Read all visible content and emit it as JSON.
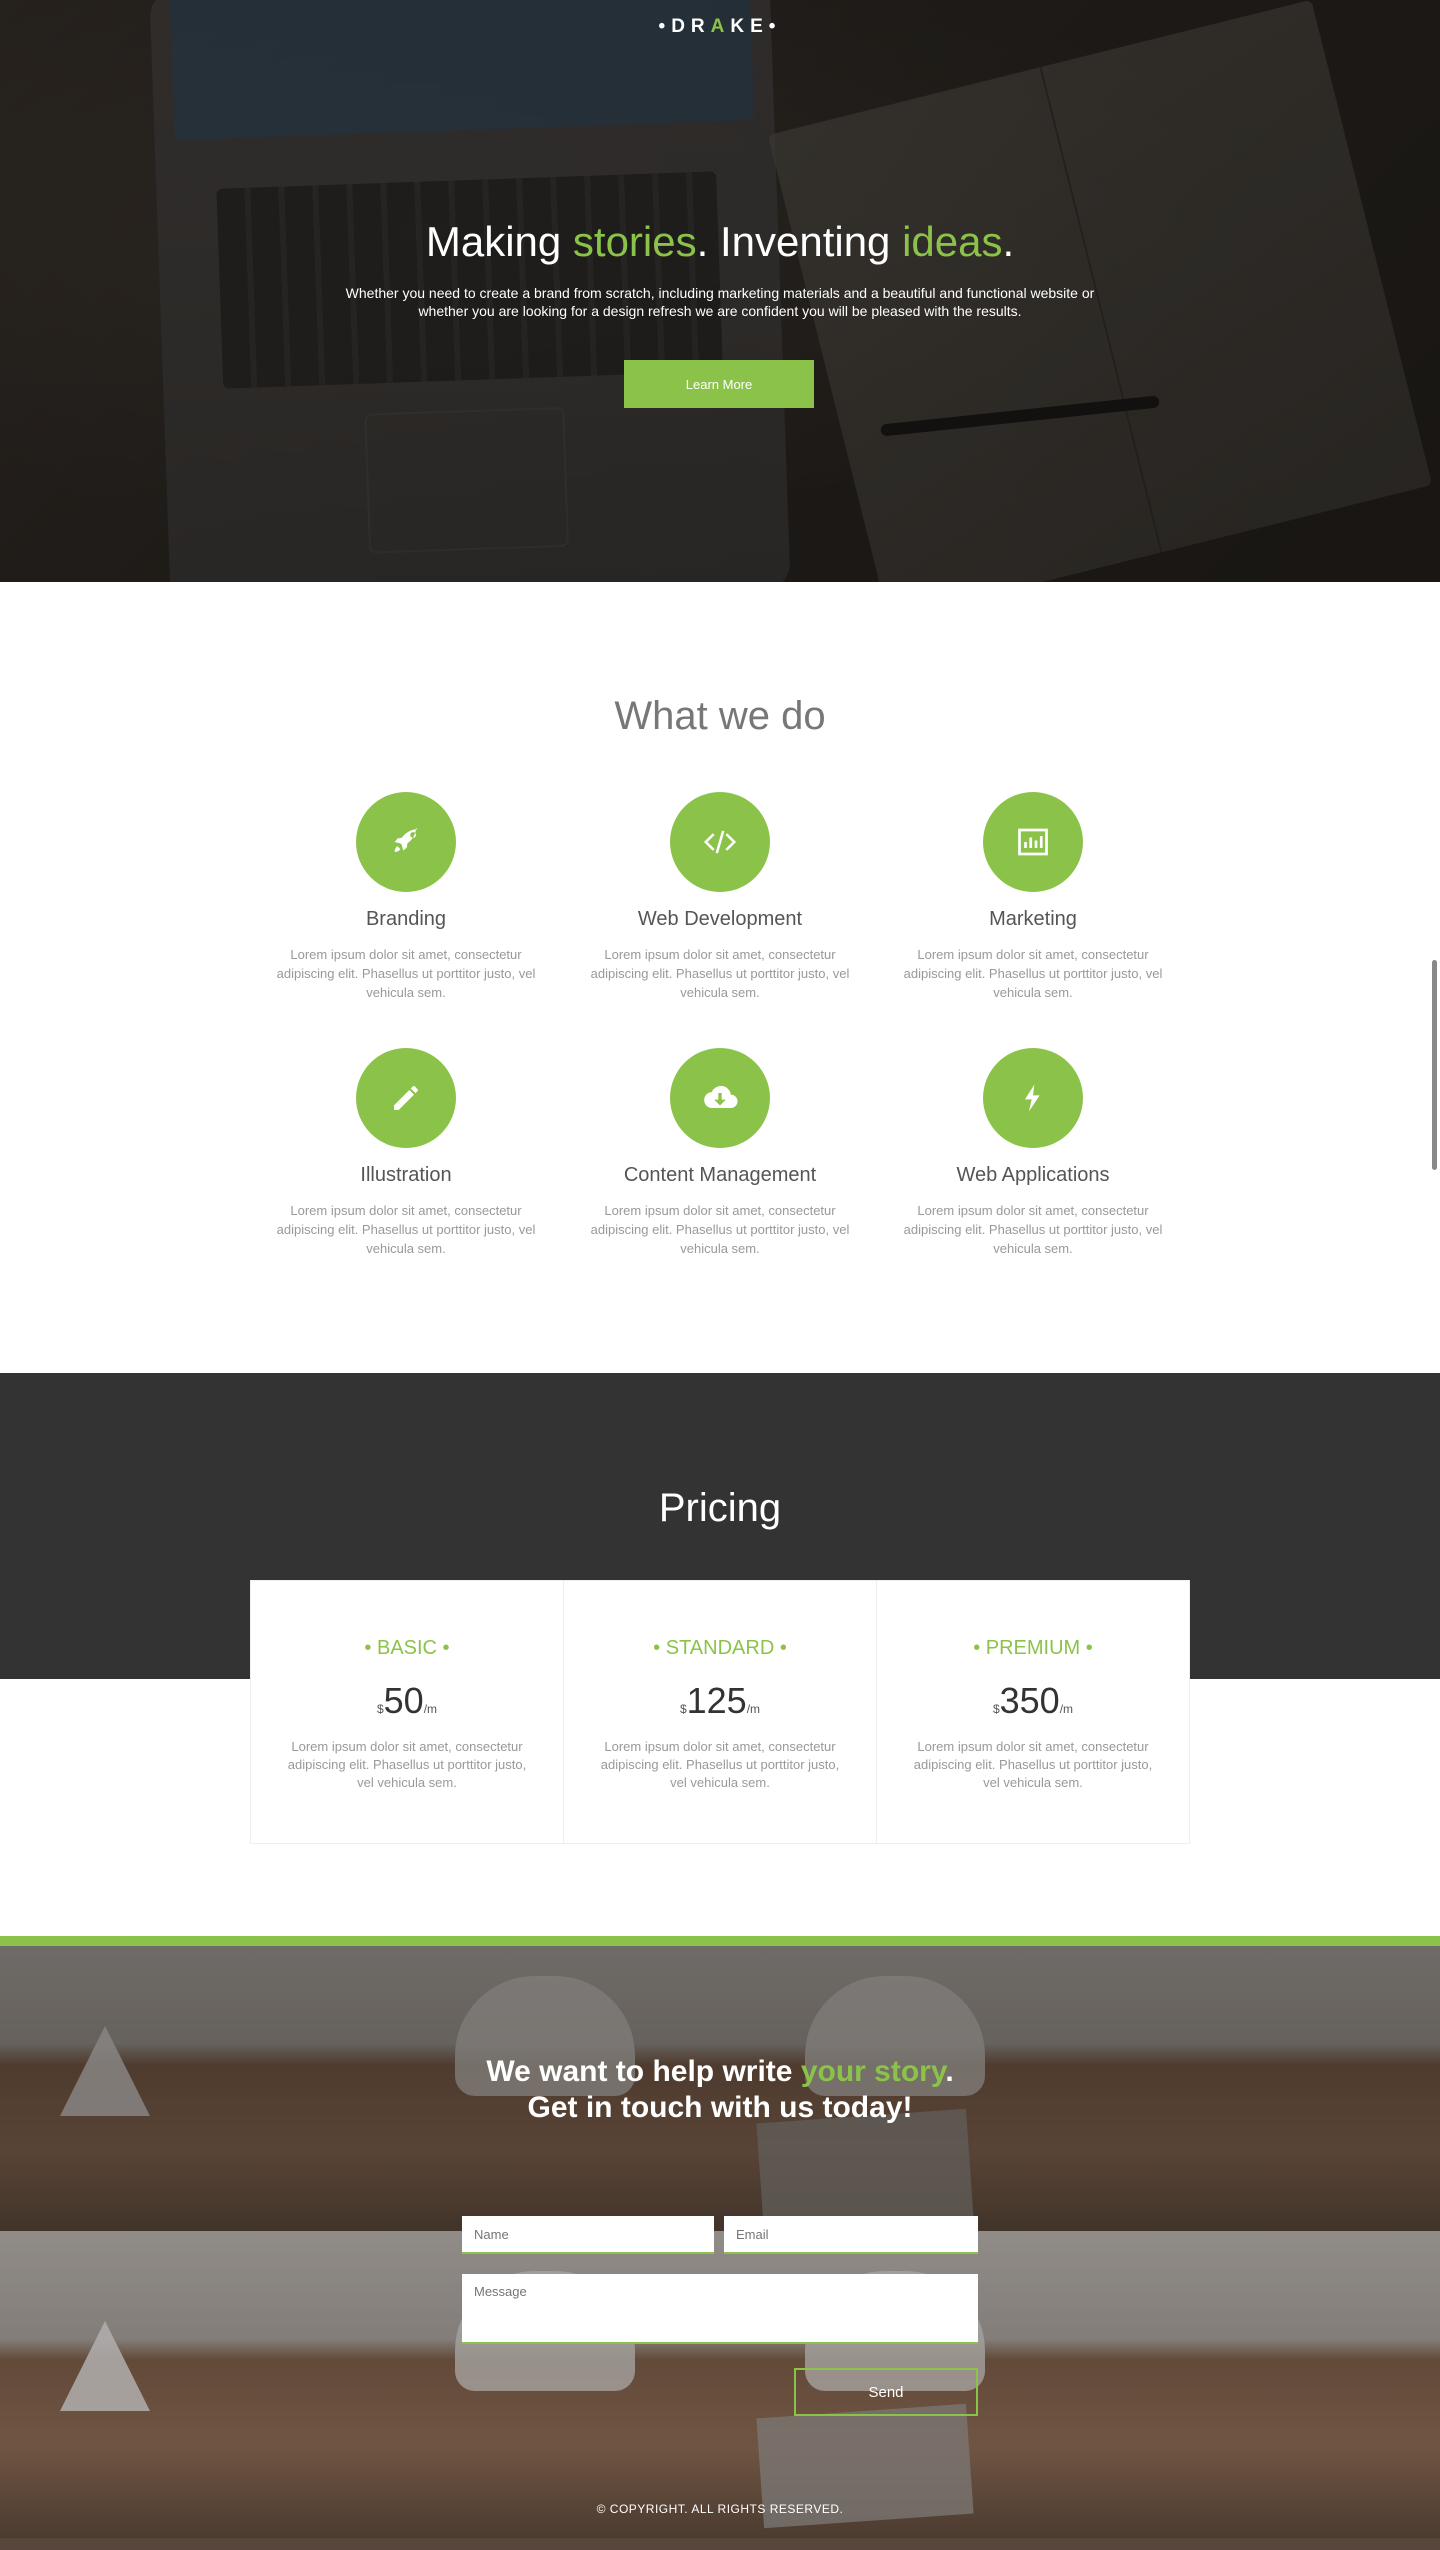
{
  "brand": {
    "dot_left": "•",
    "letter_d": "D",
    "letter_r": "R",
    "letter_a": "A",
    "letter_ke": "KE",
    "dot_right": "•",
    "accent_color": "#8bc34a"
  },
  "hero": {
    "title_part1": "Making ",
    "title_green1": "stories",
    "title_part2": ". Inventing ",
    "title_green2": "ideas",
    "title_part3": ".",
    "subtitle": "Whether you need to create a brand from scratch, including marketing materials and a beautiful and functional website or whether you are looking for a design refresh we are confident you will be pleased with the results.",
    "button_label": "Learn More"
  },
  "services": {
    "title": "What we do",
    "items": [
      {
        "name": "Branding",
        "icon": "rocket-icon",
        "desc": "Lorem ipsum dolor sit amet, consectetur adipiscing elit. Phasellus ut porttitor justo, vel vehicula sem."
      },
      {
        "name": "Web Development",
        "icon": "code-icon",
        "desc": "Lorem ipsum dolor sit amet, consectetur adipiscing elit. Phasellus ut porttitor justo, vel vehicula sem."
      },
      {
        "name": "Marketing",
        "icon": "bar-chart-icon",
        "desc": "Lorem ipsum dolor sit amet, consectetur adipiscing elit. Phasellus ut porttitor justo, vel vehicula sem."
      },
      {
        "name": "Illustration",
        "icon": "pencil-icon",
        "desc": "Lorem ipsum dolor sit amet, consectetur adipiscing elit. Phasellus ut porttitor justo, vel vehicula sem."
      },
      {
        "name": "Content Management",
        "icon": "cloud-download-icon",
        "desc": "Lorem ipsum dolor sit amet, consectetur adipiscing elit. Phasellus ut porttitor justo, vel vehicula sem."
      },
      {
        "name": "Web Applications",
        "icon": "lightning-icon",
        "desc": "Lorem ipsum dolor sit amet, consectetur adipiscing elit. Phasellus ut porttitor justo, vel vehicula sem."
      }
    ]
  },
  "pricing": {
    "title": "Pricing",
    "plans": [
      {
        "name": "• BASIC •",
        "currency": "$",
        "amount": "50",
        "period": "/m",
        "desc": "Lorem ipsum dolor sit amet, consectetur adipiscing elit. Phasellus ut porttitor justo, vel vehicula sem."
      },
      {
        "name": "• STANDARD •",
        "currency": "$",
        "amount": "125",
        "period": "/m",
        "desc": "Lorem ipsum dolor sit amet, consectetur adipiscing elit. Phasellus ut porttitor justo, vel vehicula sem."
      },
      {
        "name": "• PREMIUM •",
        "currency": "$",
        "amount": "350",
        "period": "/m",
        "desc": "Lorem ipsum dolor sit amet, consectetur adipiscing elit. Phasellus ut porttitor justo, vel vehicula sem."
      }
    ]
  },
  "contact": {
    "line1_part1": "We want to help write ",
    "line1_green": "your story",
    "line1_part2": ".",
    "line2": "Get in touch with us today!",
    "name_placeholder": "Name",
    "email_placeholder": "Email",
    "message_placeholder": "Message",
    "send_label": "Send"
  },
  "footer": {
    "copyright": "© COPYRIGHT. ALL RIGHTS RESERVED."
  }
}
